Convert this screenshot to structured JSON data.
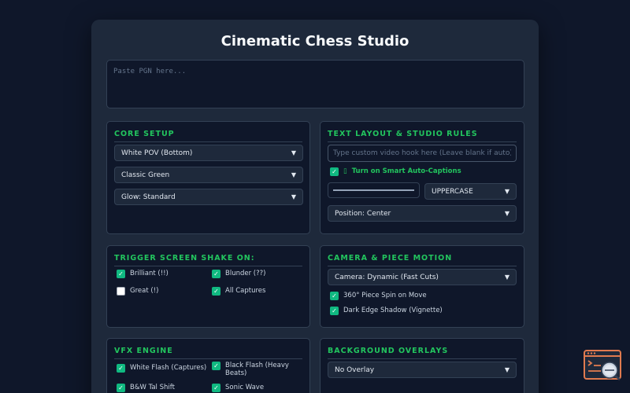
{
  "header": {
    "title": "Cinematic Chess Studio"
  },
  "pgn": {
    "placeholder": "Paste PGN here..."
  },
  "core_setup": {
    "title": "CORE SETUP",
    "pov": "White POV (Bottom)",
    "theme": "Classic Green",
    "glow": "Glow: Standard"
  },
  "text_layout": {
    "title": "TEXT LAYOUT & STUDIO RULES",
    "hook_placeholder": "Type custom video hook here (Leave blank if auto)...",
    "auto_captions_icon": "▯",
    "auto_captions_label": "Turn on Smart Auto-Captions",
    "case": "UPPERCASE",
    "position": "Position: Center",
    "accent": "#22c55e"
  },
  "shake": {
    "title": "TRIGGER SCREEN SHAKE ON:",
    "options": [
      {
        "label": "Brilliant (!!)",
        "checked": true
      },
      {
        "label": "Blunder (??)",
        "checked": true
      },
      {
        "label": "Great (!)",
        "checked": false
      },
      {
        "label": "All Captures",
        "checked": true
      }
    ]
  },
  "camera": {
    "title": "CAMERA & PIECE MOTION",
    "mode": "Camera: Dynamic (Fast Cuts)",
    "options": [
      {
        "label": "360° Piece Spin on Move",
        "checked": true
      },
      {
        "label": "Dark Edge Shadow (Vignette)",
        "checked": true
      }
    ]
  },
  "vfx": {
    "title": "VFX ENGINE",
    "options": [
      {
        "label": "White Flash (Captures)",
        "checked": true
      },
      {
        "label": "Black Flash (Heavy Beats)",
        "checked": true
      },
      {
        "label": "B&W Tal Shift",
        "checked": true
      },
      {
        "label": "Sonic Wave",
        "checked": true
      }
    ]
  },
  "overlays": {
    "title": "BACKGROUND OVERLAYS",
    "value": "No Overlay"
  },
  "colors": {
    "accent": "#22c55e",
    "checkbox": "#10b981",
    "panel": "#1e293b",
    "background": "#0f172a"
  }
}
